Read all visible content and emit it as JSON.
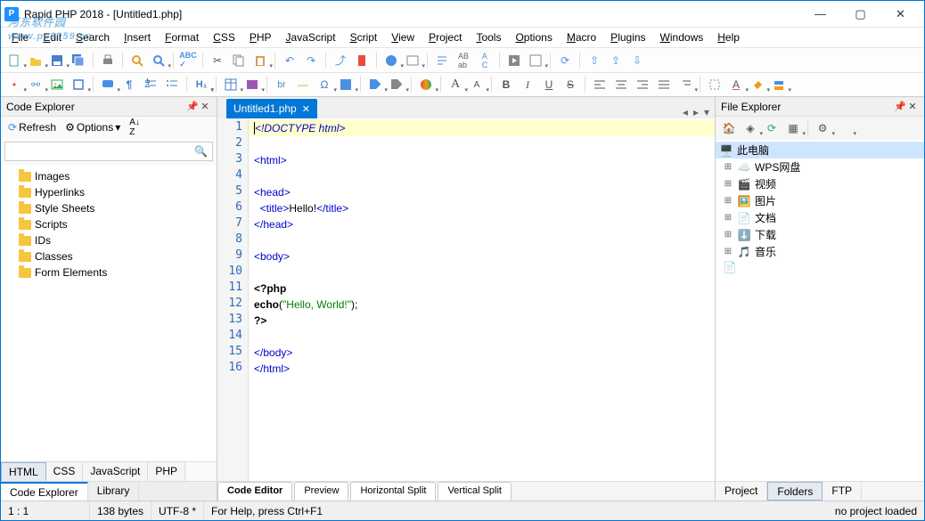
{
  "window": {
    "title": "Rapid PHP 2018 - [Untitled1.php]"
  },
  "watermark": {
    "text": "河东软件园",
    "url": "www.pc0359.cn"
  },
  "menu": [
    "File",
    "Edit",
    "Search",
    "Insert",
    "Format",
    "CSS",
    "PHP",
    "JavaScript",
    "Script",
    "View",
    "Project",
    "Tools",
    "Options",
    "Macro",
    "Plugins",
    "Windows",
    "Help"
  ],
  "code_explorer": {
    "title": "Code Explorer",
    "refresh": "Refresh",
    "options": "Options",
    "search_placeholder": "",
    "items": [
      "Images",
      "Hyperlinks",
      "Style Sheets",
      "Scripts",
      "IDs",
      "Classes",
      "Form Elements"
    ],
    "lang_tabs": [
      "HTML",
      "CSS",
      "JavaScript",
      "PHP"
    ],
    "bottom_tabs": [
      "Code Explorer",
      "Library"
    ]
  },
  "editor": {
    "tab_name": "Untitled1.php",
    "lines": [
      {
        "n": 1,
        "hl": true,
        "segs": [
          {
            "c": "tok-doctype",
            "t": "<!DOCTYPE html>"
          }
        ]
      },
      {
        "n": 2,
        "segs": []
      },
      {
        "n": 3,
        "segs": [
          {
            "c": "tok-tag",
            "t": "<html>"
          }
        ]
      },
      {
        "n": 4,
        "segs": []
      },
      {
        "n": 5,
        "segs": [
          {
            "c": "tok-tag",
            "t": "<head>"
          }
        ]
      },
      {
        "n": 6,
        "segs": [
          {
            "c": "",
            "t": "  "
          },
          {
            "c": "tok-tag",
            "t": "<title>"
          },
          {
            "c": "tok-txt",
            "t": "Hello!"
          },
          {
            "c": "tok-tag",
            "t": "</title>"
          }
        ]
      },
      {
        "n": 7,
        "segs": [
          {
            "c": "tok-tag",
            "t": "</head>"
          }
        ]
      },
      {
        "n": 8,
        "segs": []
      },
      {
        "n": 9,
        "segs": [
          {
            "c": "tok-tag",
            "t": "<body>"
          }
        ]
      },
      {
        "n": 10,
        "segs": []
      },
      {
        "n": 11,
        "segs": [
          {
            "c": "tok-php",
            "t": "<?php"
          }
        ]
      },
      {
        "n": 12,
        "segs": [
          {
            "c": "tok-kw",
            "t": "echo"
          },
          {
            "c": "",
            "t": "("
          },
          {
            "c": "tok-str",
            "t": "\"Hello, World!\""
          },
          {
            "c": "",
            "t": ");"
          }
        ]
      },
      {
        "n": 13,
        "segs": [
          {
            "c": "tok-php",
            "t": "?>"
          }
        ]
      },
      {
        "n": 14,
        "segs": []
      },
      {
        "n": 15,
        "segs": [
          {
            "c": "tok-tag",
            "t": "</body>"
          }
        ]
      },
      {
        "n": 16,
        "segs": [
          {
            "c": "tok-tag",
            "t": "</html>"
          }
        ]
      }
    ],
    "bottom_tabs": [
      "Code Editor",
      "Preview",
      "Horizontal Split",
      "Vertical Split"
    ]
  },
  "file_explorer": {
    "title": "File Explorer",
    "root": "此电脑",
    "items": [
      {
        "icon": "cloud",
        "label": "WPS网盘"
      },
      {
        "icon": "video",
        "label": "视频"
      },
      {
        "icon": "picture",
        "label": "图片"
      },
      {
        "icon": "doc",
        "label": "文档"
      },
      {
        "icon": "download",
        "label": "下载"
      },
      {
        "icon": "music",
        "label": "音乐"
      }
    ],
    "bottom_tabs": [
      "Project",
      "Folders",
      "FTP"
    ]
  },
  "status": {
    "pos": "1 : 1",
    "size": "138 bytes",
    "enc": "UTF-8 *",
    "help": "For Help, press Ctrl+F1",
    "proj": "no project loaded"
  }
}
